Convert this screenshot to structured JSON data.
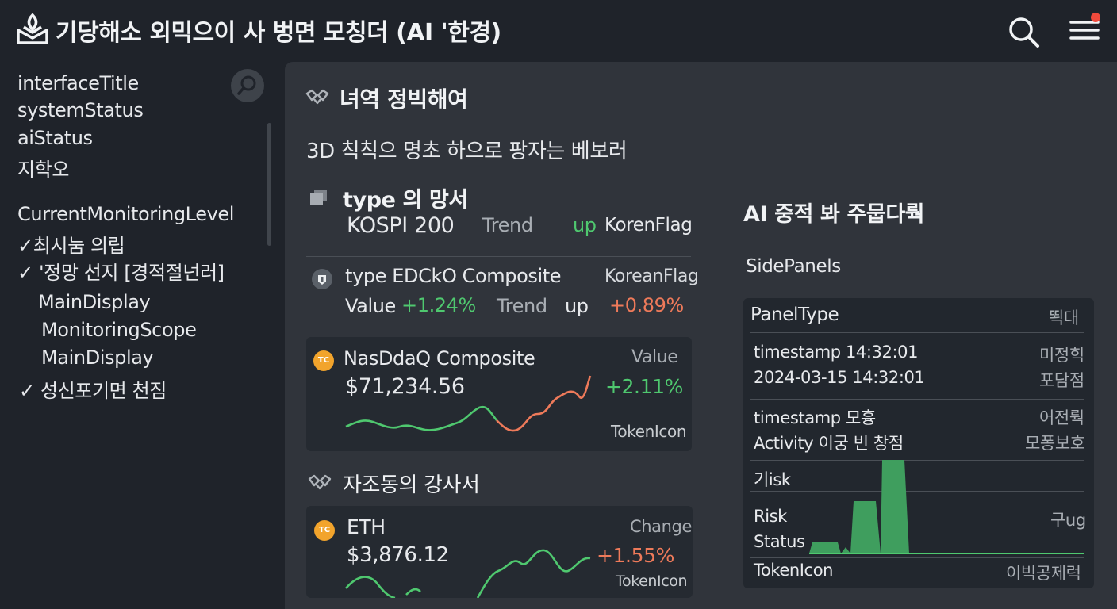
{
  "header": {
    "title": "기당해소 외믹으이 사 벙면 모칭더 (AI '한경)",
    "icons": [
      "logo-icon",
      "search-icon",
      "menu-icon"
    ],
    "notification_color": "#ef4a3c"
  },
  "sidebar": {
    "items": [
      "interfaceTitle",
      "systemStatus",
      "aiStatus",
      "지학오",
      "CurrentMonitoringLevel",
      "✓최시눔 의립",
      "✓ '정망 선지   [경적절넌러]",
      "MainDisplay",
      "MonitoringScope",
      "MainDisplay",
      "✓ 성신포기면 천짐"
    ]
  },
  "main": {
    "section1_title": "녀역 정빅해여",
    "subtitle": "3D 칙칙으 명초 하으로 팡자는 베보러",
    "kospi": {
      "heading": "type 의 망서",
      "name": "KOSPI 200",
      "trend_label": "Trend",
      "trend_value": "up",
      "flag": "KorenFlag"
    },
    "composite": {
      "name": "type EDCkO Composite",
      "flag": "KoreanFlag",
      "value_label": "Value",
      "value": "+1.24%",
      "trend_label": "Trend",
      "trend_value": "up",
      "change": "+0.89%"
    },
    "nasdaq": {
      "coin": "TC",
      "name": "NasDdaQ Composite",
      "value_label": "Value",
      "price": "$71,234.56",
      "change": "+2.11%",
      "token": "TokenIcon"
    },
    "section2_title": "자조동의 강사서",
    "eth": {
      "coin": "TC",
      "name": "ETH",
      "change_label": "Change",
      "price": "$3,876.12",
      "change": "+1.55%",
      "token": "TokenIcon"
    },
    "ai_title": "AI 중적 봐 주뭅다뤅",
    "side_panels_label": "SidePanels"
  },
  "panel": {
    "type_label": "PanelType",
    "type_value": "뙥대",
    "timestamp_line": "timestamp 14:32:01",
    "timestamp_right": "미정힉",
    "date_line": "2024-03-15 14:32:01",
    "date_right": "포담점",
    "timestamp2": "timestamp 모흉",
    "timestamp2_right": "어전뤅",
    "activity": "Activity 이궁 빈 창점",
    "activity_right": "모퐁보호",
    "risk_label": "기isk",
    "risk": "Risk",
    "status": "Status",
    "risk_right": "구ug",
    "token": "TokenIcon",
    "token_right": "이빅공제럭"
  },
  "colors": {
    "green": "#4fc86f",
    "orange": "#ee7a5a",
    "coin": "#f2a42c"
  }
}
